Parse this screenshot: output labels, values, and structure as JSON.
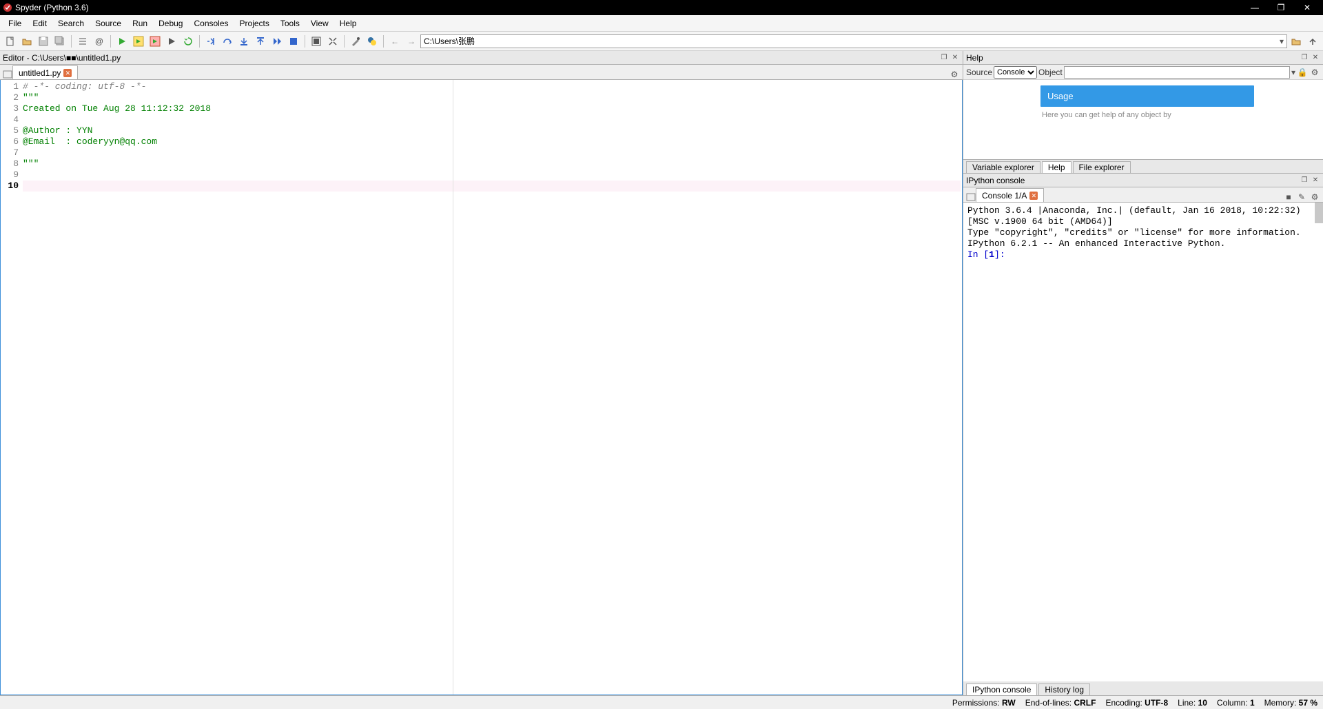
{
  "title": "Spyder (Python 3.6)",
  "menu": [
    "File",
    "Edit",
    "Search",
    "Source",
    "Run",
    "Debug",
    "Consoles",
    "Projects",
    "Tools",
    "View",
    "Help"
  ],
  "toolbar_path": "C:\\Users\\张鹏",
  "editor_header": "Editor - C:\\Users\\■■\\untitled1.py",
  "editor_tab": "untitled1.py",
  "code_lines": [
    {
      "n": "1",
      "html": "<span class=c-gray># -*- coding: utf-8 -*-</span>"
    },
    {
      "n": "2",
      "html": "<span class=c-green>\"\"\"</span>"
    },
    {
      "n": "3",
      "html": "<span class=c-green>Created on Tue Aug 28 11:12:32 2018</span>"
    },
    {
      "n": "4",
      "html": ""
    },
    {
      "n": "5",
      "html": "<span class=c-greenb>@Author : YYN</span>"
    },
    {
      "n": "6",
      "html": "<span class=c-greenb>@Email  : coderyyn@qq.com</span>"
    },
    {
      "n": "7",
      "html": ""
    },
    {
      "n": "8",
      "html": "<span class=c-green>\"\"\"</span>"
    },
    {
      "n": "9",
      "html": ""
    },
    {
      "n": "10",
      "html": "",
      "current": true
    }
  ],
  "help": {
    "header": "Help",
    "source_label": "Source",
    "source_value": "Console",
    "object_label": "Object",
    "usage_title": "Usage",
    "hint": "Here you can get help of any object by",
    "tabs": [
      "Variable explorer",
      "Help",
      "File explorer"
    ],
    "active_tab": "Help"
  },
  "ipython": {
    "header": "IPython console",
    "tab": "Console 1/A",
    "lines": [
      "Python 3.6.4 |Anaconda, Inc.| (default, Jan 16 2018, 10:22:32)",
      "[MSC v.1900 64 bit (AMD64)]",
      "Type \"copyright\", \"credits\" or \"license\" for more information.",
      "",
      "IPython 6.2.1 -- An enhanced Interactive Python.",
      ""
    ],
    "prompt_prefix": "In [",
    "prompt_num": "1",
    "prompt_suffix": "]:",
    "bottom_tabs": [
      "IPython console",
      "History log"
    ]
  },
  "status": {
    "permissions_label": "Permissions:",
    "permissions": "RW",
    "eol_label": "End-of-lines:",
    "eol": "CRLF",
    "encoding_label": "Encoding:",
    "encoding": "UTF-8",
    "line_label": "Line:",
    "line": "10",
    "col_label": "Column:",
    "col": "1",
    "mem_label": "Memory:",
    "mem": "57 %"
  }
}
